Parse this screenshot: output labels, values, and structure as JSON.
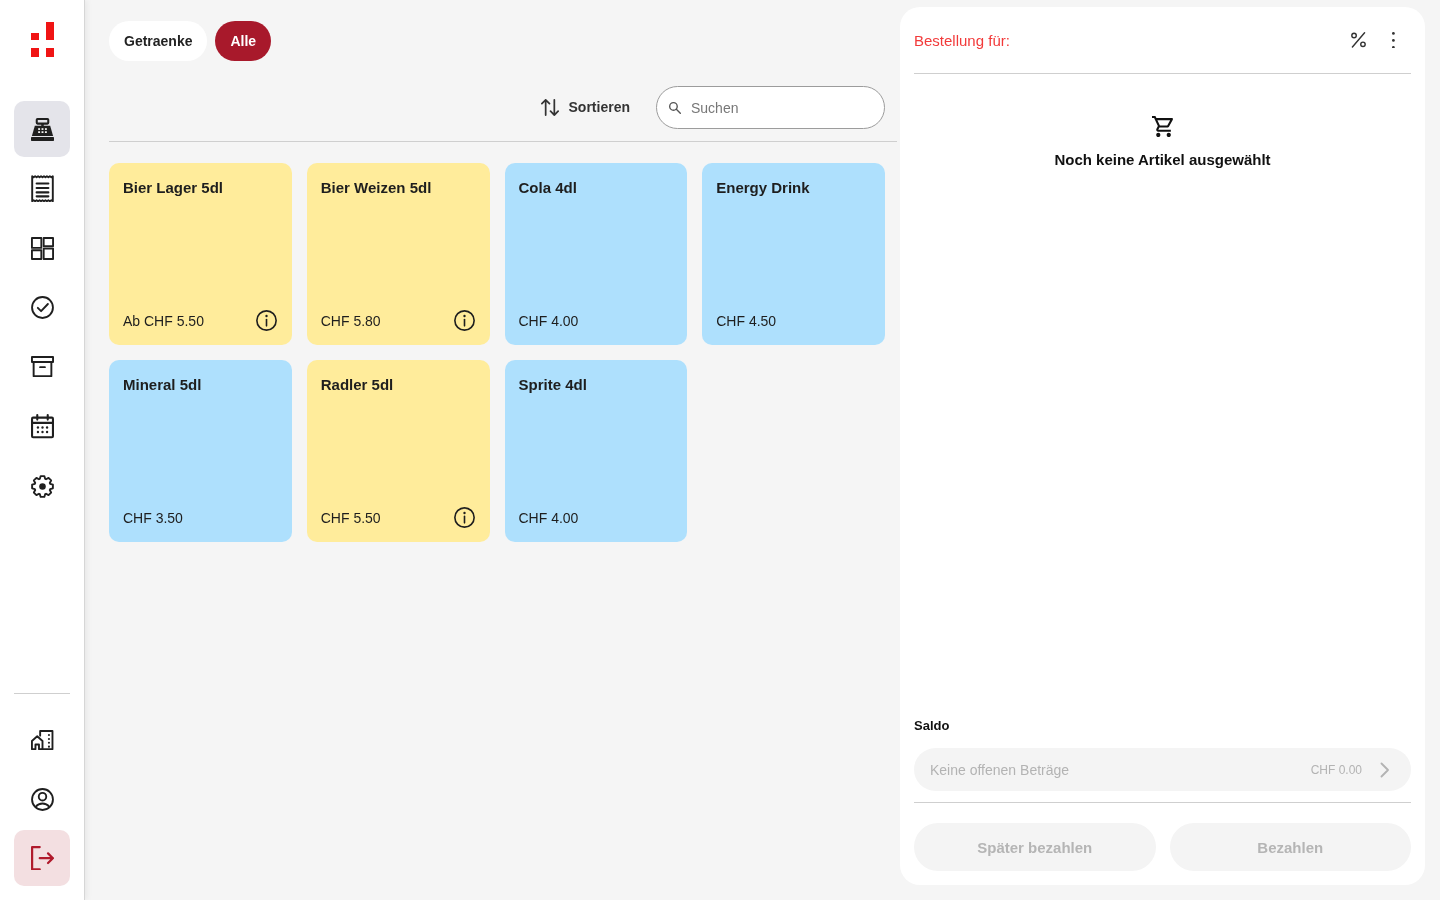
{
  "sidebar": {
    "items": [
      {
        "selected": true
      },
      {
        "selected": false
      },
      {
        "selected": false
      },
      {
        "selected": false
      },
      {
        "selected": false
      },
      {
        "selected": false
      },
      {
        "selected": false
      }
    ],
    "footer_items": [
      {
        "kind": "plain"
      },
      {
        "kind": "plain"
      },
      {
        "kind": "danger"
      }
    ]
  },
  "filters": [
    {
      "label": "Getraenke",
      "selected": false
    },
    {
      "label": "Alle",
      "selected": true
    }
  ],
  "toolbar": {
    "sort_label": "Sortieren",
    "search": {
      "placeholder": "Suchen"
    }
  },
  "products": [
    {
      "name": "Bier Lager 5dl",
      "price": "Ab CHF 5.50",
      "color": "#ffec9b",
      "info": true
    },
    {
      "name": "Bier Weizen 5dl",
      "price": "CHF 5.80",
      "color": "#ffec9b",
      "info": true
    },
    {
      "name": "Cola 4dl",
      "price": "CHF 4.00",
      "color": "#aee0fd",
      "info": false
    },
    {
      "name": "Energy Drink",
      "price": "CHF 4.50",
      "color": "#aee0fd",
      "info": false
    },
    {
      "name": "Mineral 5dl",
      "price": "CHF 3.50",
      "color": "#aee0fd",
      "info": false
    },
    {
      "name": "Radler 5dl",
      "price": "CHF 5.50",
      "color": "#ffec9b",
      "info": true
    },
    {
      "name": "Sprite 4dl",
      "price": "CHF 4.00",
      "color": "#aee0fd",
      "info": false
    }
  ],
  "order": {
    "title": "Bestellung für:",
    "empty_message": "Noch keine Artikel ausgewählt",
    "balance": {
      "label": "Saldo",
      "status": "Keine offenen Beträge",
      "amount": "CHF 0.00",
      "disabled": true
    },
    "buttons": [
      {
        "label": "Später bezahlen",
        "disabled": true
      },
      {
        "label": "Bezahlen",
        "disabled": true
      }
    ]
  }
}
